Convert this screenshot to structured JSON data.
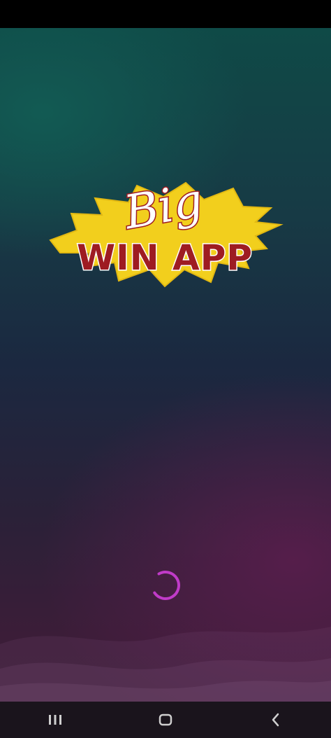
{
  "app": {
    "logo": {
      "line1": "Big",
      "line2": "WIN APP"
    }
  },
  "loading": {
    "indicator": "spinner",
    "color": "#c03bc8"
  },
  "navigation_bar": {
    "buttons": [
      {
        "icon": "recent-apps-icon"
      },
      {
        "icon": "home-icon"
      },
      {
        "icon": "back-icon"
      }
    ]
  },
  "colors": {
    "logo_yellow": "#f2cf1d",
    "logo_red": "#9e1c22",
    "bg_top": "#0f4a47",
    "bg_bottom": "#3c1e38"
  }
}
